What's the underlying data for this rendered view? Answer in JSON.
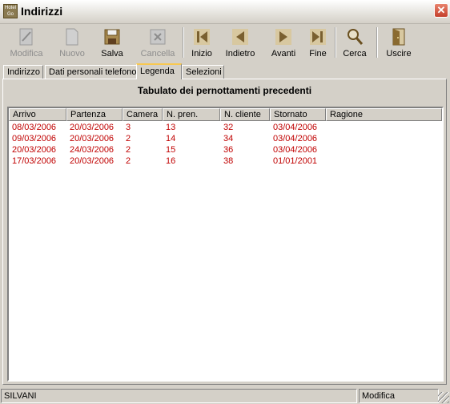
{
  "window": {
    "title": "Indirizzi",
    "icon_text": "Hotel Go",
    "close_label": "✕"
  },
  "toolbar": {
    "buttons": [
      {
        "label": "Modifica",
        "icon": "edit-icon",
        "enabled": false
      },
      {
        "label": "Nuovo",
        "icon": "new-document-icon",
        "enabled": false
      },
      {
        "label": "Salva",
        "icon": "save-disk-icon",
        "enabled": true
      },
      {
        "label": "Cancella",
        "icon": "delete-icon",
        "enabled": false
      },
      {
        "label": "Inizio",
        "icon": "first-record-icon",
        "enabled": true
      },
      {
        "label": "Indietro",
        "icon": "previous-record-icon",
        "enabled": true
      },
      {
        "label": "Avanti",
        "icon": "next-record-icon",
        "enabled": true
      },
      {
        "label": "Fine",
        "icon": "last-record-icon",
        "enabled": true
      },
      {
        "label": "Cerca",
        "icon": "magnifier-icon",
        "enabled": true
      },
      {
        "label": "Uscire",
        "icon": "exit-door-icon",
        "enabled": true
      }
    ]
  },
  "tabs": [
    {
      "label": "Indirizzo",
      "active": false
    },
    {
      "label": "Dati personali telefono",
      "active": false
    },
    {
      "label": "Legenda",
      "active": true
    },
    {
      "label": "Selezioni",
      "active": false
    }
  ],
  "panel": {
    "title": "Tabulato dei pernottamenti precedenti"
  },
  "table": {
    "columns": [
      "Arrivo",
      "Partenza",
      "Camera",
      "N. pren.",
      "N. cliente",
      "Stornato",
      "Ragione"
    ],
    "rows": [
      [
        "08/03/2006",
        "20/03/2006",
        "3",
        "13",
        "32",
        "03/04/2006",
        ""
      ],
      [
        "09/03/2006",
        "20/03/2006",
        "2",
        "14",
        "34",
        "03/04/2006",
        ""
      ],
      [
        "20/03/2006",
        "24/03/2006",
        "2",
        "15",
        "36",
        "03/04/2006",
        ""
      ],
      [
        "17/03/2006",
        "20/03/2006",
        "2",
        "16",
        "38",
        "01/01/2001",
        ""
      ]
    ],
    "row_text_color": "#c00000"
  },
  "statusbar": {
    "left": "SILVANI",
    "right": "Modifica"
  },
  "colors": {
    "window_bg": "#d4d0c8",
    "active_tab_accent": "#f8c850",
    "close_button": "#c4402c"
  }
}
